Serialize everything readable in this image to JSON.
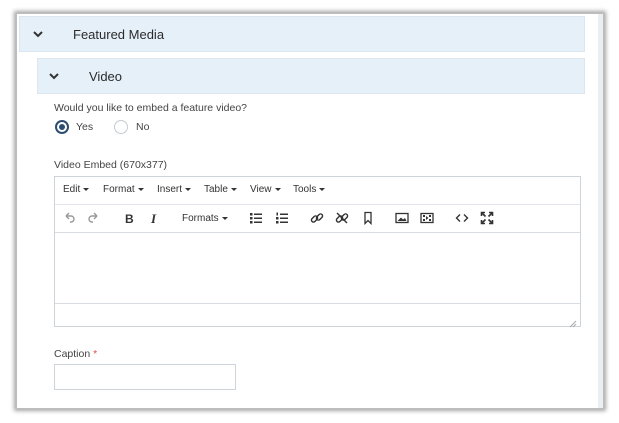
{
  "sections": {
    "outer": {
      "title": "Featured Media"
    },
    "inner": {
      "title": "Video"
    }
  },
  "question": "Would you like to embed a feature video?",
  "radio": {
    "yes_label": "Yes",
    "no_label": "No",
    "selected": "Yes"
  },
  "embed": {
    "label": "Video Embed (670x377)",
    "menu": [
      "Edit",
      "Format",
      "Insert",
      "Table",
      "View",
      "Tools"
    ],
    "formats_label": "Formats",
    "toolbar_icons": [
      "undo-icon",
      "redo-icon",
      "bold-icon",
      "italic-icon",
      "bullet-list-icon",
      "numbered-list-icon",
      "link-icon",
      "unlink-icon",
      "bookmark-icon",
      "image-icon",
      "media-icon",
      "source-code-icon",
      "fullscreen-icon"
    ]
  },
  "caption": {
    "label": "Caption",
    "required_marker": "*",
    "value": ""
  },
  "colors": {
    "panel_bg": "#e6f0f9",
    "radio_selected": "#2e4d73",
    "required": "#d9534f"
  }
}
